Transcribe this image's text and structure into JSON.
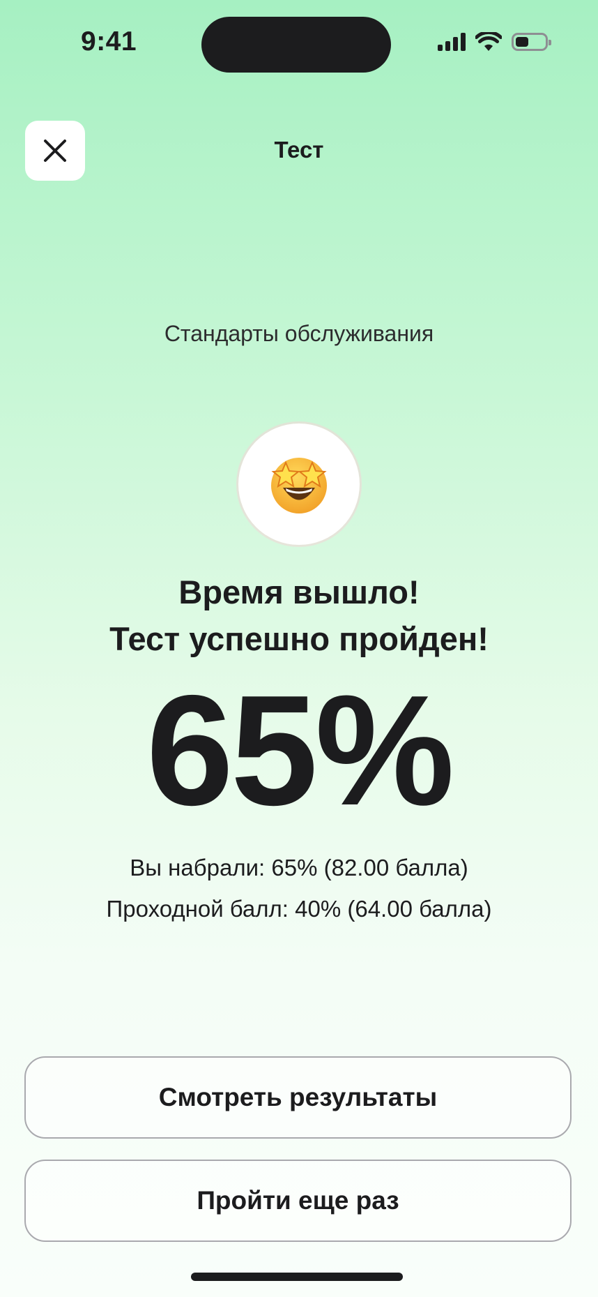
{
  "status_bar": {
    "time": "9:41",
    "battery_level": 0.45
  },
  "header": {
    "title": "Тест",
    "close_icon": "close-icon"
  },
  "test": {
    "subject": "Стандарты обслуживания",
    "emoji_icon": "star-struck-emoji-icon"
  },
  "result": {
    "headline_line1": "Время вышло!",
    "headline_line2": "Тест успешно пройден!",
    "percent": "65%",
    "scored_text": "Вы набрали: 65% (82.00 балла)",
    "passing_text": "Проходной балл: 40% (64.00 балла)"
  },
  "actions": {
    "view_results_label": "Смотреть результаты",
    "retry_label": "Пройти еще раз"
  },
  "colors": {
    "gradient_top": "#a6f0c2",
    "gradient_bottom": "#f9fefa",
    "text": "#1c1c1e",
    "button_border": "#a9a9ae"
  }
}
